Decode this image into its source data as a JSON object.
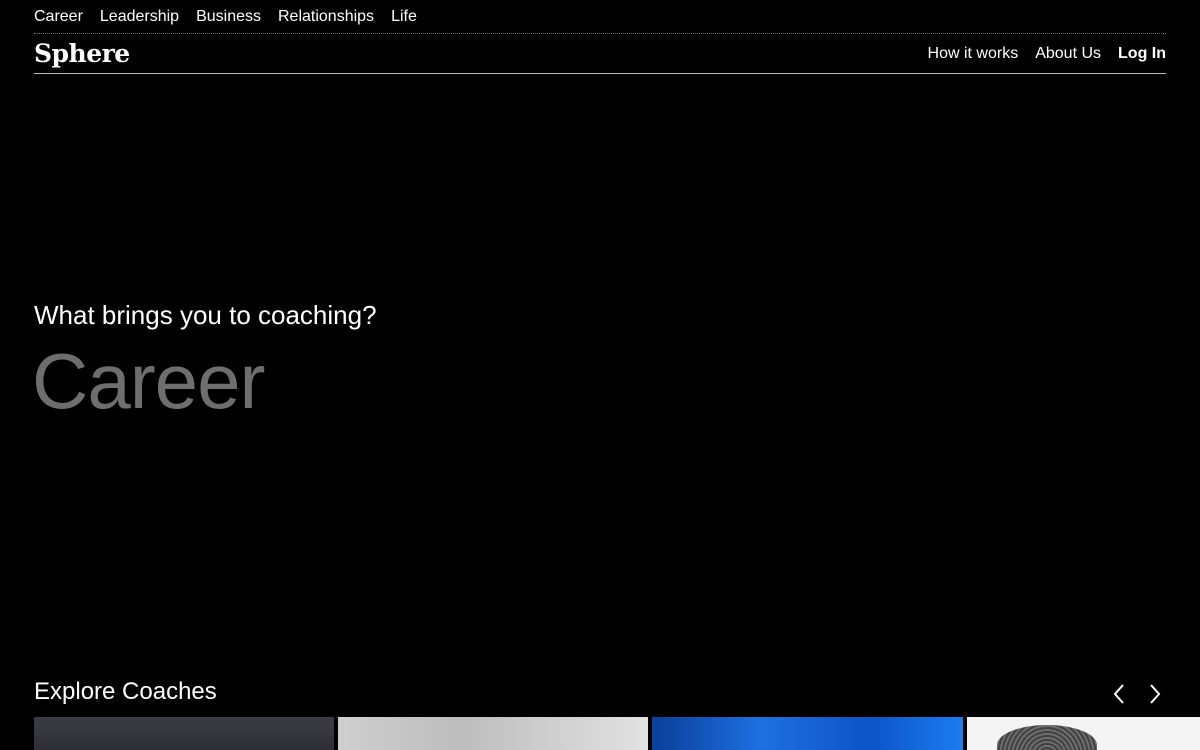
{
  "top_nav": {
    "items": [
      "Career",
      "Leadership",
      "Business",
      "Relationships",
      "Life"
    ]
  },
  "header": {
    "logo": "Sphere",
    "nav": {
      "how_it_works": "How it works",
      "about_us": "About Us",
      "log_in": "Log In"
    }
  },
  "hero": {
    "question": "What brings you to coaching?",
    "rotating_word": "Career",
    "rotating_word_color": "#6e6e6e"
  },
  "explore": {
    "title": "Explore Coaches",
    "prev_icon": "chevron-left-icon",
    "next_icon": "chevron-right-icon"
  },
  "colors": {
    "background": "#000000",
    "text": "#ffffff",
    "muted": "#6e6e6e"
  }
}
